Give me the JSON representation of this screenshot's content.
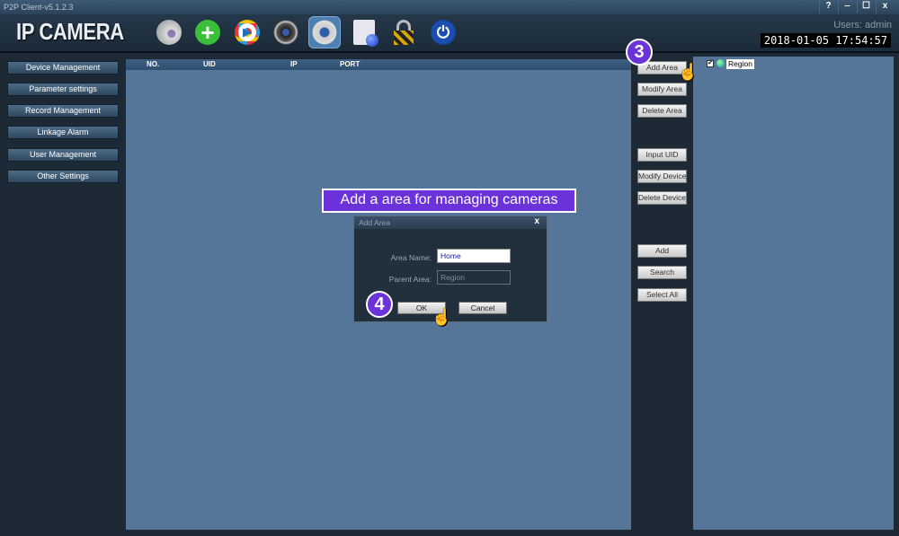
{
  "window": {
    "title": "P2P Client-v5.1.2.3",
    "controls": [
      "?",
      "‒",
      "☐",
      "x"
    ]
  },
  "header": {
    "logo": "IP CAMERA",
    "users": "Users: admin",
    "datetime": "2018-01-05 17:54:57",
    "toolbar": [
      "camera-icon",
      "add-icon",
      "play-icon",
      "reel-icon",
      "settings-icon",
      "log-icon",
      "lock-icon",
      "power-icon"
    ]
  },
  "sidebar": [
    "Device Management",
    "Parameter settings",
    "Record Management",
    "Linkage Alarm",
    "User Management",
    "Other Settings"
  ],
  "table": {
    "columns": [
      "NO.",
      "UID",
      "IP",
      "PORT"
    ]
  },
  "right_buttons": [
    "Add Area",
    "Modify Area",
    "Delete Area",
    "Input UID",
    "Modify Device",
    "Delete Device",
    "Add",
    "Search",
    "Select All"
  ],
  "tree": {
    "root": "Region",
    "checked": true
  },
  "caption": "Add a area for managing cameras",
  "steps": [
    "3",
    "4"
  ],
  "dialog": {
    "title": "Add Area",
    "close": "x",
    "area_name_label": "Area Name:",
    "area_name_value": "Home",
    "parent_area_label": "Parent Area:",
    "parent_area_value": "Region",
    "ok": "OK",
    "cancel": "Cancel"
  }
}
